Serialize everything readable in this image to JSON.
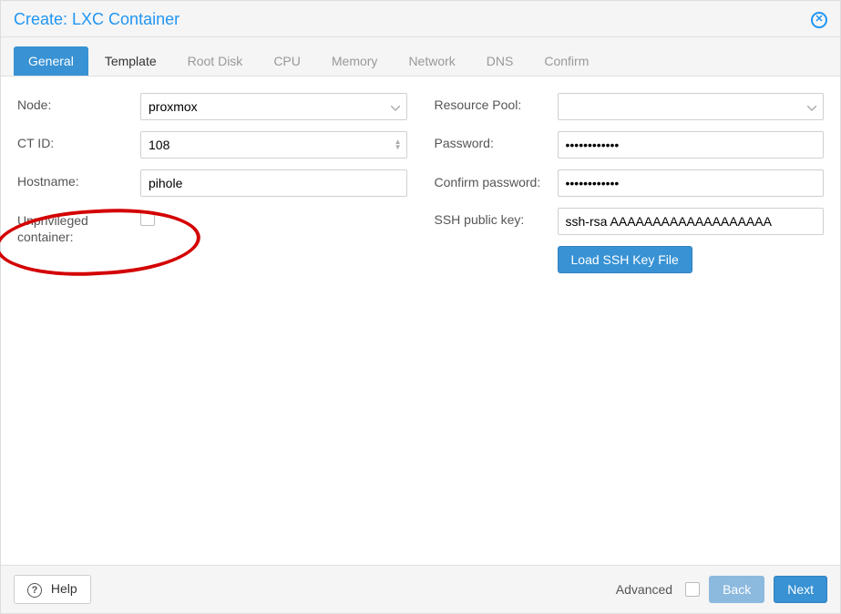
{
  "header": {
    "title": "Create: LXC Container"
  },
  "tabs": {
    "general": "General",
    "template": "Template",
    "rootdisk": "Root Disk",
    "cpu": "CPU",
    "memory": "Memory",
    "network": "Network",
    "dns": "DNS",
    "confirm": "Confirm"
  },
  "left": {
    "node_label": "Node:",
    "node_value": "proxmox",
    "ctid_label": "CT ID:",
    "ctid_value": "108",
    "hostname_label": "Hostname:",
    "hostname_value": "pihole",
    "unpriv_label": "Unprivileged container:"
  },
  "right": {
    "pool_label": "Resource Pool:",
    "pool_value": "",
    "password_label": "Password:",
    "password_value": "••••••••••••",
    "confirm_label": "Confirm password:",
    "confirm_value": "••••••••••••",
    "sshkey_label": "SSH public key:",
    "sshkey_value": "ssh-rsa AAAAAAAAAAAAAAAAAAA",
    "loadkey_btn": "Load SSH Key File"
  },
  "footer": {
    "help": "Help",
    "advanced": "Advanced",
    "back": "Back",
    "next": "Next"
  }
}
